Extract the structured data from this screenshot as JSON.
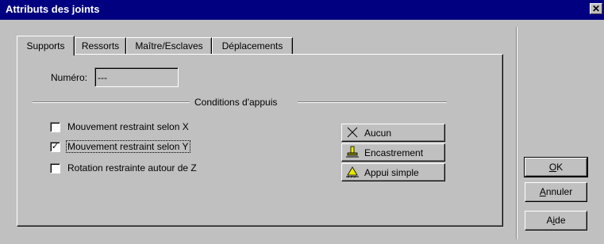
{
  "window": {
    "title": "Attributs des joints",
    "close_glyph": "✕"
  },
  "tabs": [
    {
      "label": "Supports",
      "active": true
    },
    {
      "label": "Ressorts",
      "active": false
    },
    {
      "label": "Maître/Esclaves",
      "active": false
    },
    {
      "label": "Déplacements",
      "active": false
    }
  ],
  "numero": {
    "label": "Numéro:",
    "value": "---"
  },
  "group": {
    "title": "Conditions d'appuis"
  },
  "checkboxes": [
    {
      "label": "Mouvement restraint selon X",
      "checked": false
    },
    {
      "label": "Mouvement restraint selon Y",
      "checked": true
    },
    {
      "label": "Rotation restrainte autour de Z",
      "checked": false
    }
  ],
  "presets": [
    {
      "label": "Aucun",
      "icon": "x-icon"
    },
    {
      "label": "Encastrement",
      "icon": "fixed-support-icon"
    },
    {
      "label": "Appui simple",
      "icon": "pinned-support-icon"
    }
  ],
  "dialog_buttons": {
    "ok_pre": "",
    "ok_u": "O",
    "ok_post": "K",
    "cancel_pre": "",
    "cancel_u": "A",
    "cancel_post": "nnuler",
    "help_pre": "A",
    "help_u": "i",
    "help_post": "de"
  },
  "check_glyph": "✓"
}
